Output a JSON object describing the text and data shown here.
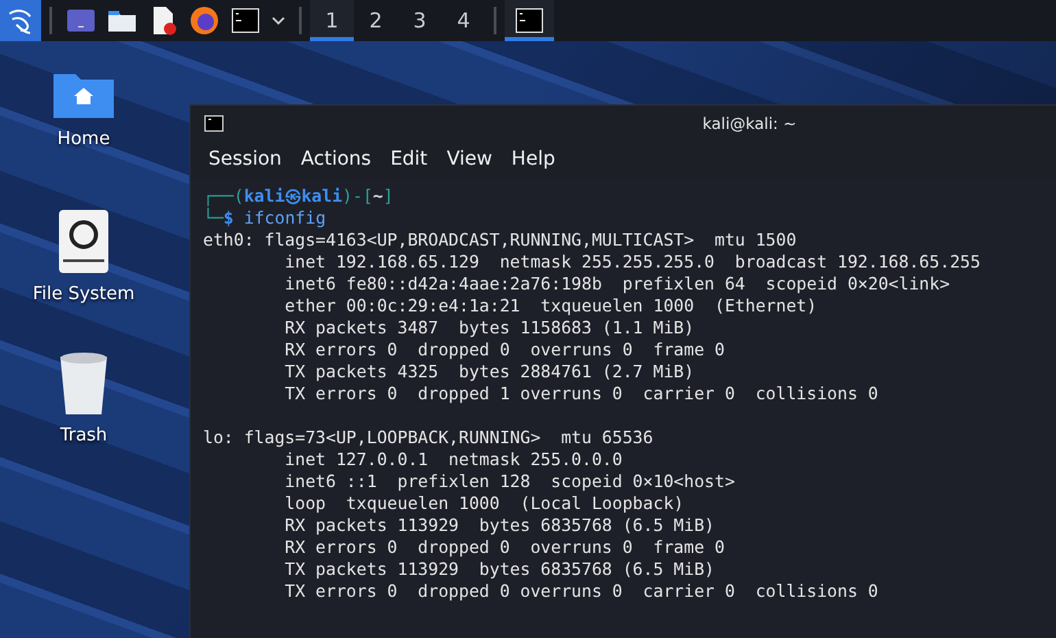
{
  "taskbar": {
    "launchers": [
      {
        "kind": "desktop"
      },
      {
        "kind": "folder"
      },
      {
        "kind": "editor"
      },
      {
        "kind": "browser"
      },
      {
        "kind": "terminal"
      }
    ],
    "workspaces": [
      {
        "label": "1",
        "selected": true
      },
      {
        "label": "2",
        "selected": false
      },
      {
        "label": "3",
        "selected": false
      },
      {
        "label": "4",
        "selected": false
      }
    ],
    "tasks": [
      {
        "kind": "terminal",
        "selected": true
      }
    ]
  },
  "desktop_icons": [
    {
      "label": "Home",
      "kind": "home"
    },
    {
      "label": "File System",
      "kind": "drive"
    },
    {
      "label": "Trash",
      "kind": "trash"
    }
  ],
  "terminal": {
    "title": "kali@kali: ~",
    "menu": [
      "Session",
      "Actions",
      "Edit",
      "View",
      "Help"
    ],
    "prompt": {
      "open": "┌──(",
      "user": "kali",
      "at": "㉿",
      "host": "kali",
      "mid": ")-[",
      "path": "~",
      "close": "]",
      "corner": "└─",
      "sign": "$",
      "command": "ifconfig"
    },
    "output": [
      [
        "eth0: flags=4163<UP,BROADCAST,RUNNING,MULTICAST>  mtu 1500",
        "        inet 192.168.65.129  netmask 255.255.255.0  broadcast 192.168.65.255",
        "        inet6 fe80::d42a:4aae:2a76:198b  prefixlen 64  scopeid 0×20<link>",
        "        ether 00:0c:29:e4:1a:21  txqueuelen 1000  (Ethernet)",
        "        RX packets 3487  bytes 1158683 (1.1 MiB)",
        "        RX errors 0  dropped 0  overruns 0  frame 0",
        "        TX packets 4325  bytes 2884761 (2.7 MiB)",
        "        TX errors 0  dropped 1 overruns 0  carrier 0  collisions 0"
      ],
      [
        "lo: flags=73<UP,LOOPBACK,RUNNING>  mtu 65536",
        "        inet 127.0.0.1  netmask 255.0.0.0",
        "        inet6 ::1  prefixlen 128  scopeid 0×10<host>",
        "        loop  txqueuelen 1000  (Local Loopback)",
        "        RX packets 113929  bytes 6835768 (6.5 MiB)",
        "        RX errors 0  dropped 0  overruns 0  frame 0",
        "        TX packets 113929  bytes 6835768 (6.5 MiB)",
        "        TX errors 0  dropped 0 overruns 0  carrier 0  collisions 0"
      ]
    ]
  }
}
